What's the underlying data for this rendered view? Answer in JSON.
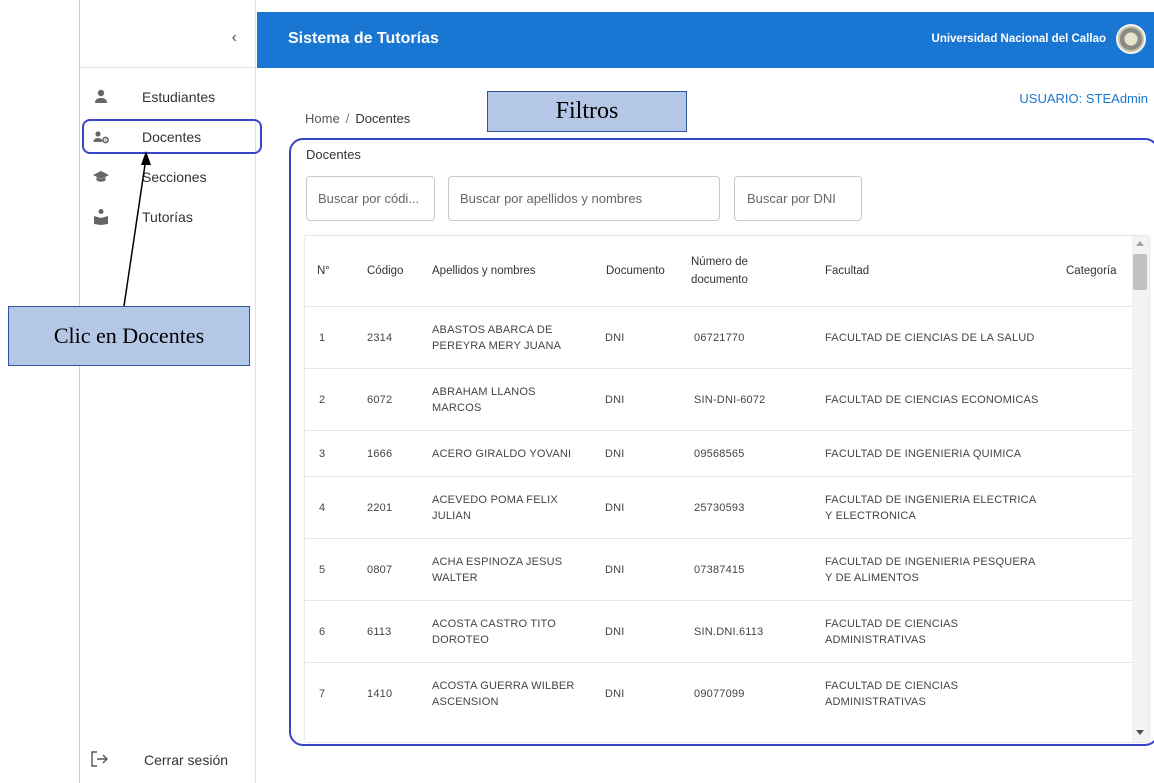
{
  "sidebar": {
    "collapse_icon": "chevron-left-icon",
    "items": [
      {
        "label": "Estudiantes",
        "icon": "person-icon"
      },
      {
        "label": "Docentes",
        "icon": "teacher-gear-icon"
      },
      {
        "label": "Secciones",
        "icon": "graduation-cap-icon"
      },
      {
        "label": "Tutorías",
        "icon": "reading-person-icon"
      }
    ],
    "logout": {
      "label": "Cerrar sesión",
      "icon": "logout-icon"
    }
  },
  "header": {
    "title": "Sistema de Tutorías",
    "university": "Universidad Nacional del Callao",
    "bg_color": "#1976d2"
  },
  "user": {
    "label": "USUARIO: STEAdmin"
  },
  "breadcrumb": {
    "home": "Home",
    "separator": "/",
    "current": "Docentes"
  },
  "annotations": {
    "filtros": "Filtros",
    "clic": "Clic en Docentes",
    "outline_color": "#3a44c9",
    "box_color": "#b4c7e7"
  },
  "card": {
    "title": "Docentes",
    "filters": {
      "codigo": "Buscar por códi...",
      "nombres": "Buscar por apellidos y nombres",
      "dni": "Buscar por DNI"
    }
  },
  "table": {
    "headers": {
      "num": "N°",
      "codigo": "Código",
      "nombres": "Apellidos y nombres",
      "documento": "Documento",
      "numdoc_1": "Número de",
      "numdoc_2": "documento",
      "facultad": "Facultad",
      "categoria": "Categoría"
    },
    "rows": [
      {
        "n": "1",
        "codigo": "2314",
        "nombres": [
          "ABASTOS ABARCA DE",
          "PEREYRA MERY JUANA"
        ],
        "documento": "DNI",
        "numdoc": "06721770",
        "facultad": [
          "FACULTAD DE CIENCIAS DE LA SALUD"
        ]
      },
      {
        "n": "2",
        "codigo": "6072",
        "nombres": [
          "ABRAHAM LLANOS",
          "MARCOS"
        ],
        "documento": "DNI",
        "numdoc": "SIN-DNI-6072",
        "facultad": [
          "FACULTAD DE CIENCIAS ECONOMICAS"
        ]
      },
      {
        "n": "3",
        "codigo": "1666",
        "nombres": [
          "ACERO GIRALDO YOVANI"
        ],
        "documento": "DNI",
        "numdoc": "09568565",
        "facultad": [
          "FACULTAD DE INGENIERIA QUIMICA"
        ]
      },
      {
        "n": "4",
        "codigo": "2201",
        "nombres": [
          "ACEVEDO POMA FELIX",
          "JULIAN"
        ],
        "documento": "DNI",
        "numdoc": "25730593",
        "facultad": [
          "FACULTAD DE INGENIERIA ELECTRICA",
          "Y ELECTRONICA"
        ]
      },
      {
        "n": "5",
        "codigo": "0807",
        "nombres": [
          "ACHA ESPINOZA JESUS",
          "WALTER"
        ],
        "documento": "DNI",
        "numdoc": "07387415",
        "facultad": [
          "FACULTAD DE INGENIERIA PESQUERA",
          "Y DE ALIMENTOS"
        ]
      },
      {
        "n": "6",
        "codigo": "6113",
        "nombres": [
          "ACOSTA CASTRO TITO",
          "DOROTEO"
        ],
        "documento": "DNI",
        "numdoc": "SIN.DNI.6113",
        "facultad": [
          "FACULTAD DE CIENCIAS",
          "ADMINISTRATIVAS"
        ]
      },
      {
        "n": "7",
        "codigo": "1410",
        "nombres": [
          "ACOSTA GUERRA WILBER",
          "ASCENSION"
        ],
        "documento": "DNI",
        "numdoc": "09077099",
        "facultad": [
          "FACULTAD DE CIENCIAS",
          "ADMINISTRATIVAS"
        ]
      }
    ]
  }
}
